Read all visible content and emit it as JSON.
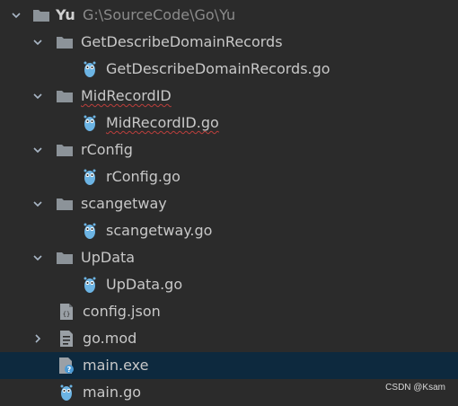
{
  "project": {
    "name": "Yu",
    "path": "G:\\SourceCode\\Go\\Yu"
  },
  "items": [
    {
      "label": "GetDescribeDomainRecords"
    },
    {
      "label": "GetDescribeDomainRecords.go"
    },
    {
      "label": "MidRecordID"
    },
    {
      "label": "MidRecordID.go"
    },
    {
      "label": "rConfig"
    },
    {
      "label": "rConfig.go"
    },
    {
      "label": "scangetway"
    },
    {
      "label": "scangetway.go"
    },
    {
      "label": "UpData"
    },
    {
      "label": "UpData.go"
    },
    {
      "label": "config.json"
    },
    {
      "label": "go.mod"
    },
    {
      "label": "main.exe"
    },
    {
      "label": "main.go"
    }
  ],
  "colors": {
    "background": "#2b2b2b",
    "selection": "#0d293e",
    "folder": "#8c9399",
    "gopher": "#6cb4e4",
    "error_underline": "#bc3f3c"
  },
  "watermark": "CSDN @Ksam"
}
